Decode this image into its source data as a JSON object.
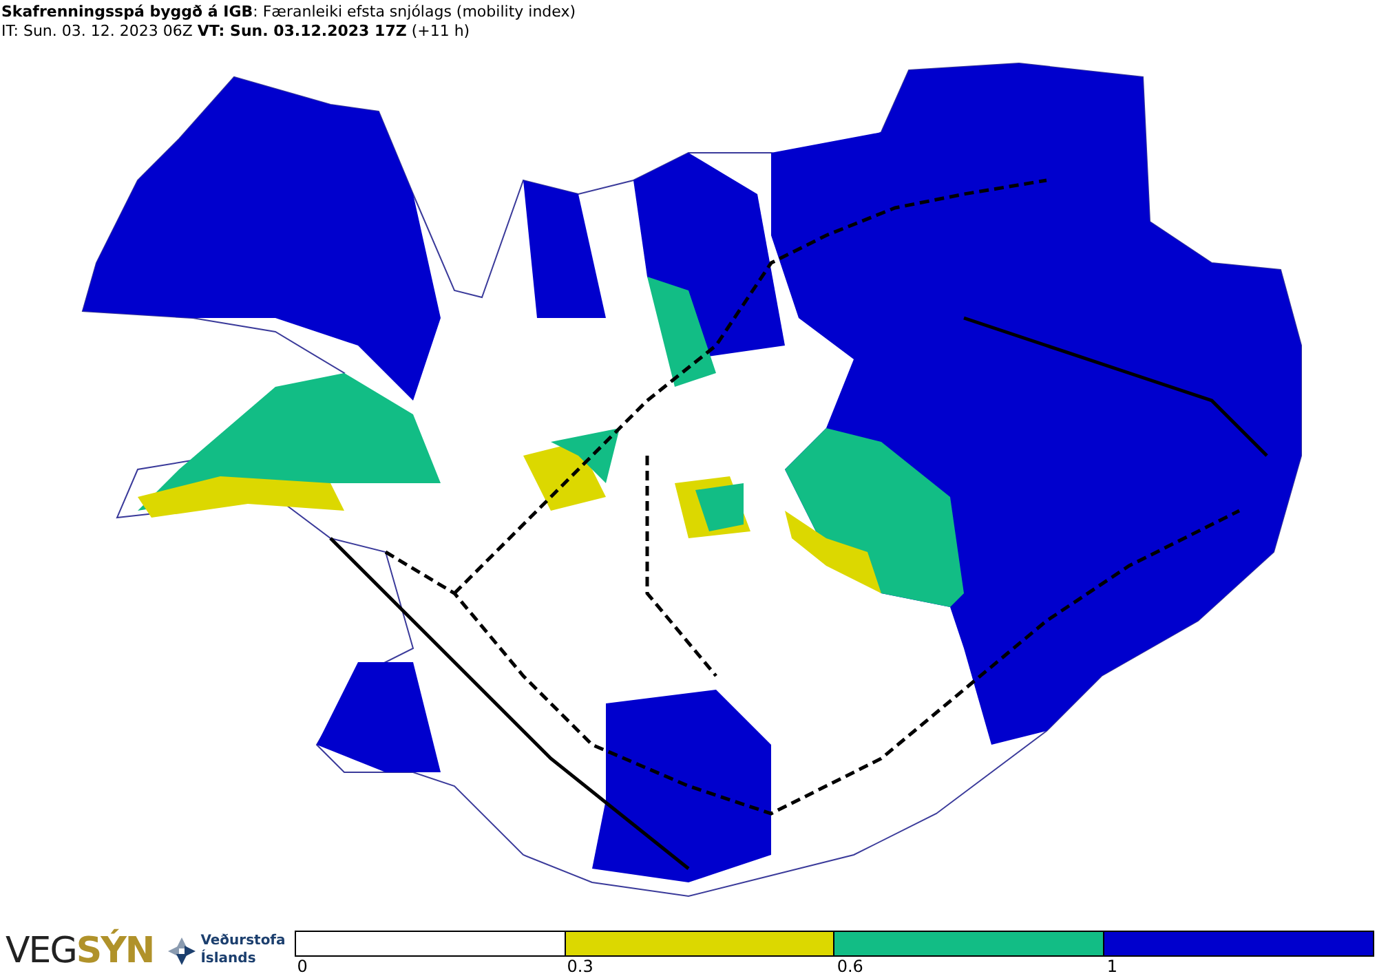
{
  "header": {
    "title": "**Skafrenningsspá byggð á IGB**: Færanleiki efsta snjólags (mobility index)",
    "subtitle": "IT: Sun. 03. 12. 2023 06Z **VT: Sun. 03.12.2023 17Z** (+11 h)"
  },
  "logos": {
    "vegsyn_left": "VEG",
    "vegsyn_right": "SÝN",
    "vedur_line1": "Veðurstofa",
    "vedur_line2": "Íslands"
  },
  "legend": {
    "segments": [
      {
        "color": "#ffffff"
      },
      {
        "color": "#dcd800"
      },
      {
        "color": "#12bd85"
      },
      {
        "color": "#0000cd"
      }
    ],
    "ticks": [
      "0",
      "0.3",
      "0.6",
      "1"
    ]
  }
}
